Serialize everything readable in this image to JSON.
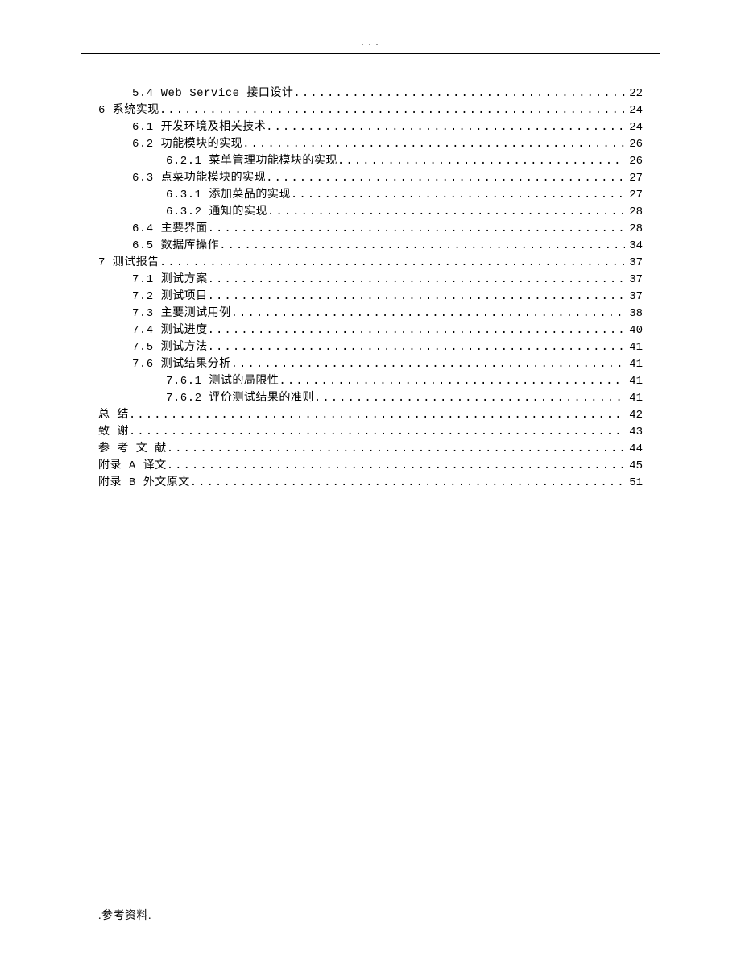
{
  "header_mark": ". . .",
  "footer": ".参考资料.",
  "toc": [
    {
      "level": 1,
      "label": "5.4 Web Service 接口设计",
      "page": "22"
    },
    {
      "level": 0,
      "label": "6  系统实现",
      "page": "24"
    },
    {
      "level": 1,
      "label": "6.1 开发环境及相关技术",
      "page": "24"
    },
    {
      "level": 1,
      "label": "6.2 功能模块的实现",
      "page": "26"
    },
    {
      "level": 2,
      "label": "6.2.1 菜单管理功能模块的实现",
      "page": "26"
    },
    {
      "level": 1,
      "label": "6.3 点菜功能模块的实现",
      "page": "27"
    },
    {
      "level": 2,
      "label": "6.3.1 添加菜品的实现",
      "page": "27"
    },
    {
      "level": 2,
      "label": "6.3.2 通知的实现",
      "page": "28"
    },
    {
      "level": 1,
      "label": "6.4 主要界面",
      "page": "28"
    },
    {
      "level": 1,
      "label": "6.5 数据库操作",
      "page": "34"
    },
    {
      "level": 0,
      "label": "7  测试报告",
      "page": "37"
    },
    {
      "level": 1,
      "label": "7.1 测试方案",
      "page": "37"
    },
    {
      "level": 1,
      "label": "7.2 测试项目",
      "page": "37"
    },
    {
      "level": 1,
      "label": "7.3 主要测试用例",
      "page": "38"
    },
    {
      "level": 1,
      "label": "7.4 测试进度",
      "page": "40"
    },
    {
      "level": 1,
      "label": "7.5 测试方法",
      "page": "41"
    },
    {
      "level": 1,
      "label": "7.6 测试结果分析",
      "page": "41"
    },
    {
      "level": 2,
      "label": "7.6.1 测试的局限性",
      "page": "41"
    },
    {
      "level": 2,
      "label": "7.6.2 评价测试结果的准则",
      "page": "41"
    },
    {
      "level": 0,
      "label": "总  结",
      "page": "42"
    },
    {
      "level": 0,
      "label": "致  谢",
      "page": "43"
    },
    {
      "level": 0,
      "label": "参 考 文 献",
      "page": "44"
    },
    {
      "level": 0,
      "label": "附录 A  译文",
      "page": "45"
    },
    {
      "level": 0,
      "label": "附录 B  外文原文",
      "page": "51"
    }
  ]
}
